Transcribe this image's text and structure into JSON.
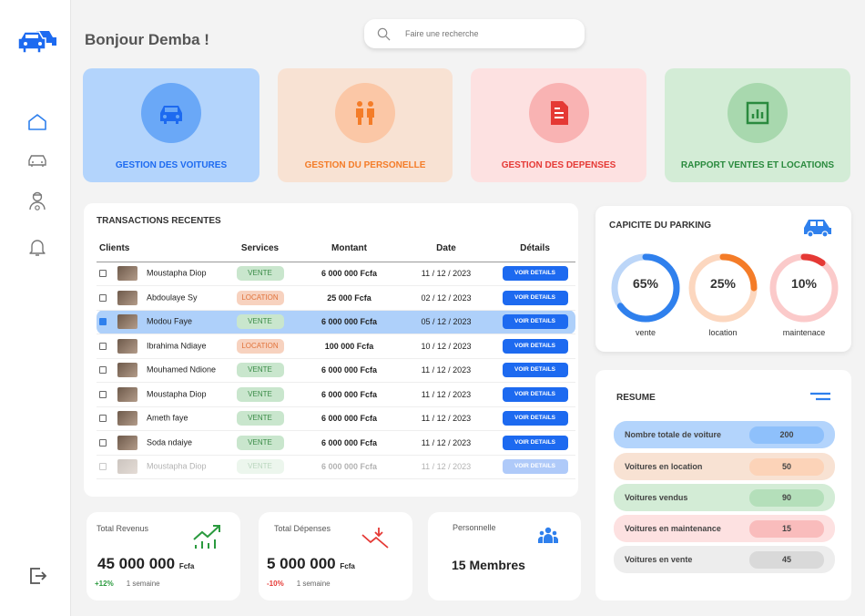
{
  "greeting": "Bonjour Demba !",
  "search": {
    "placeholder": "Faire une recherche"
  },
  "cards": [
    {
      "label": "GESTION DES VOITURES",
      "bg": "#b3d4fc",
      "circle": "#6aa8f7",
      "color": "#1d6af0",
      "icon": "car-icon"
    },
    {
      "label": "GESTION DU PERSONELLE",
      "bg": "#f8e2d3",
      "circle": "#fbc7a6",
      "color": "#f47c28",
      "icon": "people-icon"
    },
    {
      "label": "GESTION DES DEPENSES",
      "bg": "#fde1e1",
      "circle": "#f9b3b3",
      "color": "#e53935",
      "icon": "document-icon"
    },
    {
      "label": "RAPPORT VENTES  ET LOCATIONS",
      "bg": "#d3ecd6",
      "circle": "#a8d8ae",
      "color": "#2a8a3e",
      "icon": "report-chart-icon"
    }
  ],
  "transactions": {
    "title": "TRANSACTIONS RECENTES",
    "headers": [
      "Clients",
      "Services",
      "Montant",
      "Date",
      "Détails"
    ],
    "button_label": "VOIR DETAILS",
    "rows": [
      {
        "name": "Moustapha Diop",
        "service": "VENTE",
        "amount": "6 000 000 Fcfa",
        "date": "11 / 12 / 2023"
      },
      {
        "name": "Abdoulaye Sy",
        "service": "LOCATION",
        "amount": "25 000 Fcfa",
        "date": "02 / 12 / 2023"
      },
      {
        "name": "Modou Faye",
        "service": "VENTE",
        "amount": "6 000 000 Fcfa",
        "date": "05 / 12 / 2023"
      },
      {
        "name": "Ibrahima Ndiaye",
        "service": "LOCATION",
        "amount": "100 000 Fcfa",
        "date": "10 / 12 / 2023"
      },
      {
        "name": "Mouhamed Ndione",
        "service": "VENTE",
        "amount": "6 000 000 Fcfa",
        "date": "11 / 12 / 2023"
      },
      {
        "name": "Moustapha Diop",
        "service": "VENTE",
        "amount": "6 000 000 Fcfa",
        "date": "11 / 12 / 2023"
      },
      {
        "name": "Ameth faye",
        "service": "VENTE",
        "amount": "6 000 000 Fcfa",
        "date": "11 / 12 / 2023"
      },
      {
        "name": "Soda ndaiye",
        "service": "VENTE",
        "amount": "6 000 000 Fcfa",
        "date": "11 / 12 / 2023"
      },
      {
        "name": "Moustapha Diop",
        "service": "VENTE",
        "amount": "6 000 000 Fcfa",
        "date": "11 / 12 / 2023"
      }
    ]
  },
  "parking": {
    "title": "CAPICITE DU PARKING",
    "gauges": [
      {
        "value": "65%",
        "percent": 65,
        "label": "vente",
        "color": "#2f80ed",
        "track": "#bcd6f8"
      },
      {
        "value": "25%",
        "percent": 25,
        "label": "location",
        "color": "#f47c28",
        "track": "#fcd7bf"
      },
      {
        "value": "10%",
        "percent": 10,
        "label": "maintenace",
        "color": "#e53935",
        "track": "#fbcaca"
      }
    ]
  },
  "resume": {
    "title": "RESUME",
    "rows": [
      {
        "label": "Nombre totale de voiture",
        "value": "200",
        "bg": "#b3d4fc",
        "pill": "#8ec0fb"
      },
      {
        "label": "Voitures  en location",
        "value": "50",
        "bg": "#f8e2d3",
        "pill": "#fcd3b8"
      },
      {
        "label": "Voitures  vendus",
        "value": "90",
        "bg": "#d3ecd6",
        "pill": "#b4dfba"
      },
      {
        "label": "Voitures  en maintenance",
        "value": "15",
        "bg": "#fde1e1",
        "pill": "#f9bcbc"
      },
      {
        "label": "Voitures  en vente",
        "value": "45",
        "bg": "#ededed",
        "pill": "#d9d9d9"
      }
    ]
  },
  "stats": {
    "revenus": {
      "title": "Total Revenus",
      "amount": "45 000 000",
      "unit": "Fcfa",
      "delta": "+12%",
      "period": "1 semaine"
    },
    "depenses": {
      "title": "Total Dépenses",
      "amount": "5 000 000",
      "unit": "Fcfa",
      "delta": "-10%",
      "period": "1 semaine"
    },
    "personnel": {
      "title": "Personnelle",
      "amount": "15 Membres"
    }
  }
}
